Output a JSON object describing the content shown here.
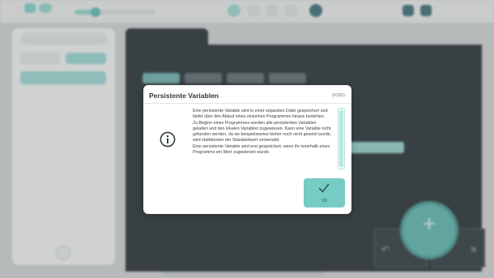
{
  "dialog": {
    "title": "Persistente Variablen",
    "id": "(#295)",
    "icon": "info-icon",
    "body": "Eine persistente Variable wird in einer separaten Datei gespeichert und bleibt über den Ablauf eines einzelnen Programmes hinaus bestehen.\nZu Beginn eines Programmes werden alle persistenten Variablen geladen und den lokalen Variablen zugewiesen. Kann eine Variable nicht gefunden werden, da sie beispielsweise bisher noch nicht gesetzt wurde, wird stattdessen der Standardwert verwendet.\nEine persistente Variable wird erst gespeichert, wenn ihr innerhalb eines Programms ein Wert zugewiesen wurde.",
    "ok_label": "OK",
    "ok_icon": "checkmark-icon"
  },
  "colors": {
    "accent": "#76cbc3",
    "dark_panel": "#3d4549",
    "dialog_bg": "#ffffff"
  },
  "background": {
    "speed_level": 0.2
  }
}
